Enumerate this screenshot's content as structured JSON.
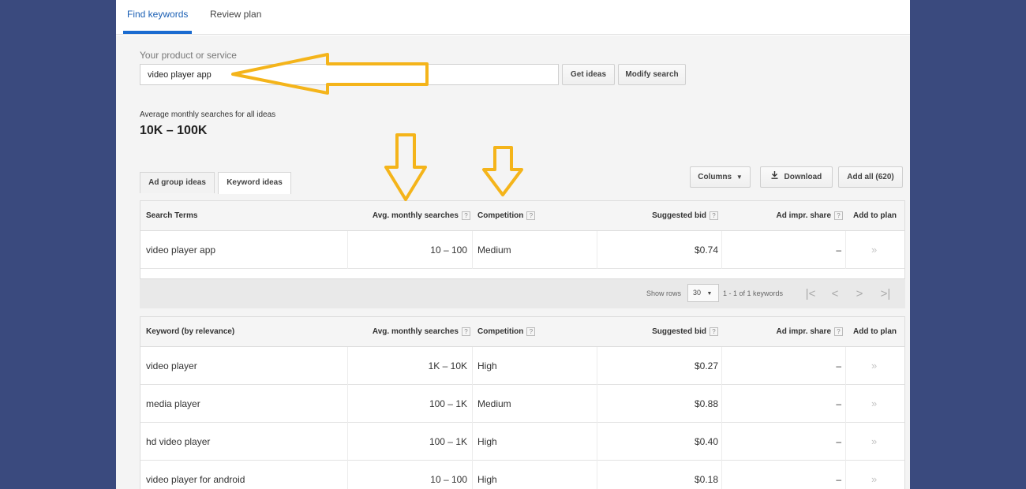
{
  "tabs": {
    "find_keywords": "Find keywords",
    "review_plan": "Review plan"
  },
  "search": {
    "label": "Your product or service",
    "value": "video player app",
    "get_ideas": "Get ideas",
    "modify_search": "Modify search"
  },
  "summary": {
    "label": "Average monthly searches for all ideas",
    "value": "10K – 100K"
  },
  "subtabs": {
    "ad_group_ideas": "Ad group ideas",
    "keyword_ideas": "Keyword ideas"
  },
  "toolbar": {
    "columns": "Columns",
    "download": "Download",
    "add_all": "Add all (620)"
  },
  "search_terms_table": {
    "headers": {
      "term": "Search Terms",
      "avg": "Avg. monthly searches",
      "competition": "Competition",
      "bid": "Suggested bid",
      "impr": "Ad impr. share",
      "add": "Add to plan"
    },
    "rows": [
      {
        "term": "video player app",
        "avg": "10 – 100",
        "competition": "Medium",
        "bid": "$0.74",
        "impr": "–"
      }
    ]
  },
  "pager": {
    "show_rows_label": "Show rows",
    "rows_value": "30",
    "range": "1 - 1 of 1 keywords"
  },
  "keyword_table": {
    "headers": {
      "term": "Keyword (by relevance)",
      "avg": "Avg. monthly searches",
      "competition": "Competition",
      "bid": "Suggested bid",
      "impr": "Ad impr. share",
      "add": "Add to plan"
    },
    "rows": [
      {
        "term": "video player",
        "avg": "1K – 10K",
        "competition": "High",
        "bid": "$0.27",
        "impr": "–"
      },
      {
        "term": "media player",
        "avg": "100 – 1K",
        "competition": "Medium",
        "bid": "$0.88",
        "impr": "–"
      },
      {
        "term": "hd video player",
        "avg": "100 – 1K",
        "competition": "High",
        "bid": "$0.40",
        "impr": "–"
      },
      {
        "term": "video player for android",
        "avg": "10 – 100",
        "competition": "High",
        "bid": "$0.18",
        "impr": "–"
      }
    ]
  },
  "help_glyph": "?",
  "add_glyph": "»",
  "colors": {
    "background": "#3a4a7e",
    "accent": "#1a6bd0",
    "annotation_arrow": "#f4b41a"
  }
}
